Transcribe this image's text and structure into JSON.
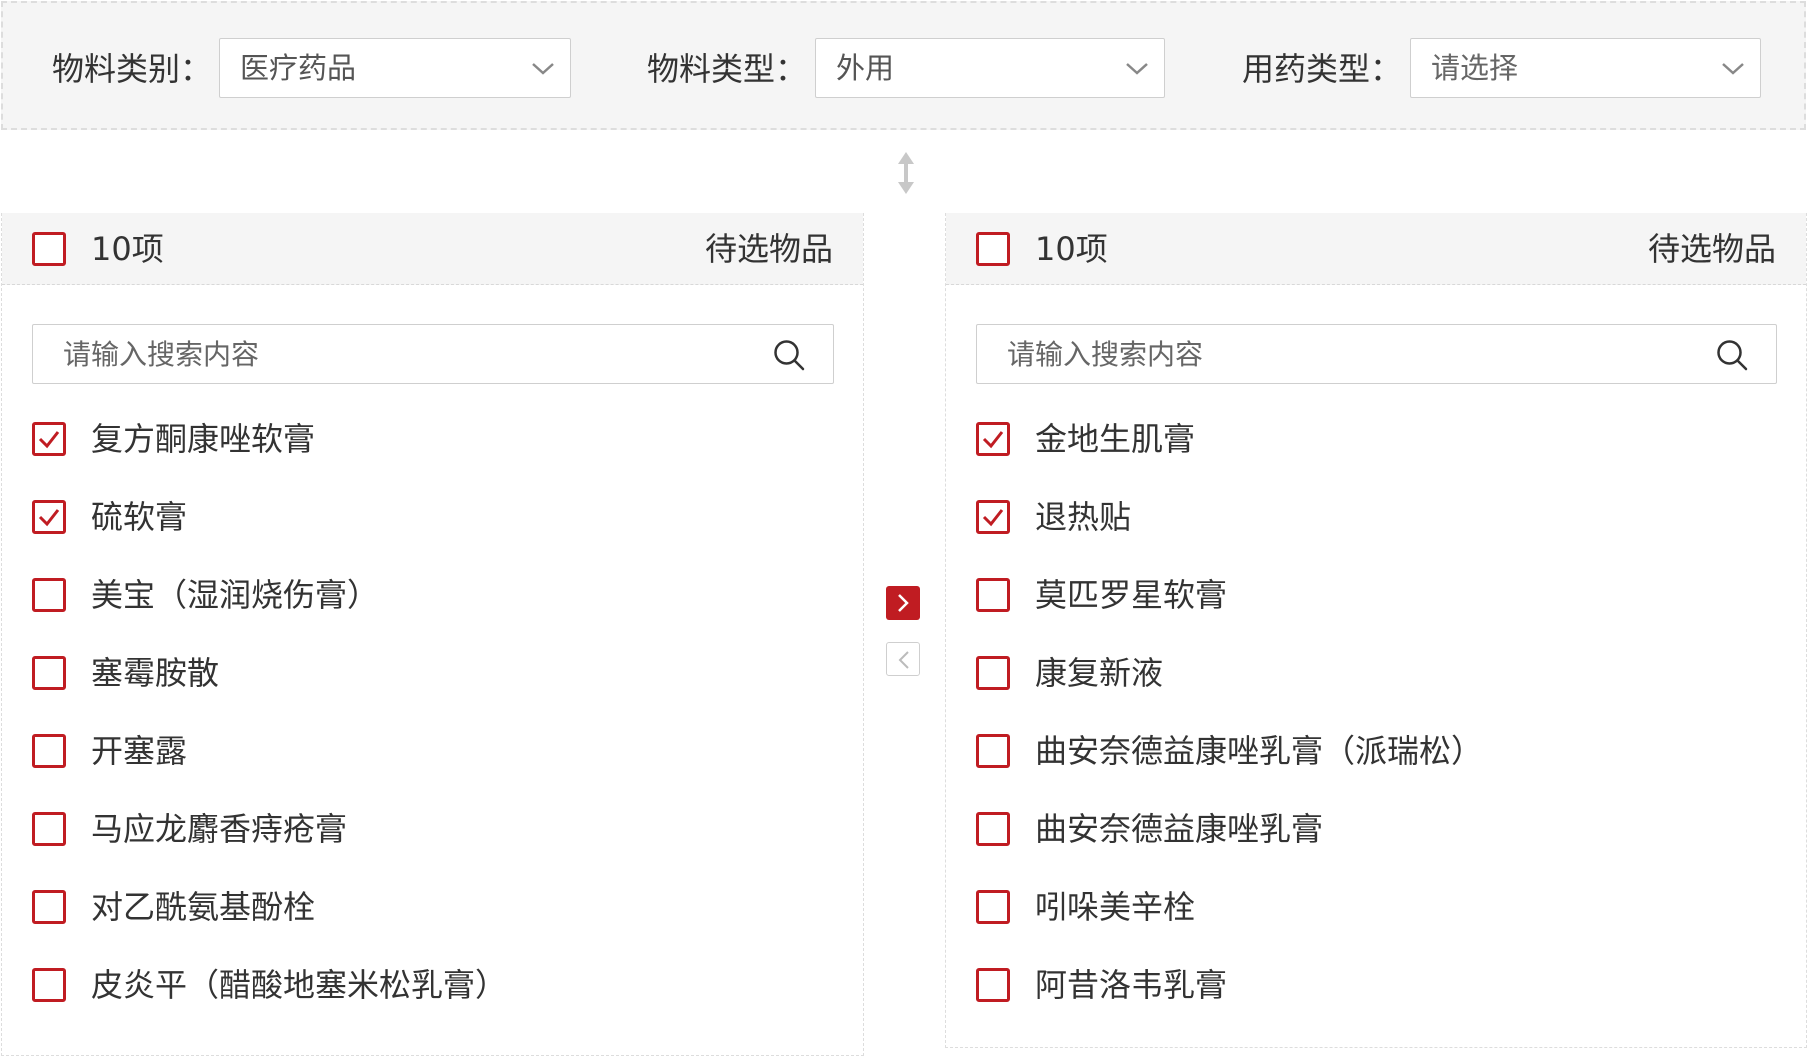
{
  "filters": [
    {
      "label": "物料类别：",
      "value": "医疗药品",
      "is_placeholder": false
    },
    {
      "label": "物料类型：",
      "value": "外用",
      "is_placeholder": false
    },
    {
      "label": "用药类型：",
      "value": "请选择",
      "is_placeholder": true
    }
  ],
  "icons": {
    "dropdown": "chevron-down-icon",
    "resize": "vertical-resize-icon",
    "search": "search-icon",
    "move_right": "chevron-right-icon",
    "move_left": "chevron-left-icon"
  },
  "colors": {
    "accent": "#c01c22",
    "header_bg": "#f5f5f5",
    "border": "#dddddd",
    "text": "#333333"
  },
  "left_panel": {
    "count": "10项",
    "title": "待选物品",
    "select_all_checked": false,
    "search_placeholder": "请输入搜索内容",
    "items": [
      {
        "label": "复方酮康唑软膏",
        "checked": true
      },
      {
        "label": "硫软膏",
        "checked": true
      },
      {
        "label": "美宝（湿润烧伤膏）",
        "checked": false
      },
      {
        "label": "塞霉胺散",
        "checked": false
      },
      {
        "label": "开塞露",
        "checked": false
      },
      {
        "label": "马应龙麝香痔疮膏",
        "checked": false
      },
      {
        "label": "对乙酰氨基酚栓",
        "checked": false
      },
      {
        "label": "皮炎平（醋酸地塞米松乳膏）",
        "checked": false
      }
    ]
  },
  "right_panel": {
    "count": "10项",
    "title": "待选物品",
    "select_all_checked": false,
    "search_placeholder": "请输入搜索内容",
    "items": [
      {
        "label": "金地生肌膏",
        "checked": true
      },
      {
        "label": "退热贴",
        "checked": true
      },
      {
        "label": "莫匹罗星软膏",
        "checked": false
      },
      {
        "label": "康复新液",
        "checked": false
      },
      {
        "label": "曲安奈德益康唑乳膏（派瑞松）",
        "checked": false
      },
      {
        "label": "曲安奈德益康唑乳膏",
        "checked": false
      },
      {
        "label": "吲哚美辛栓",
        "checked": false
      },
      {
        "label": "阿昔洛韦乳膏",
        "checked": false
      }
    ]
  }
}
